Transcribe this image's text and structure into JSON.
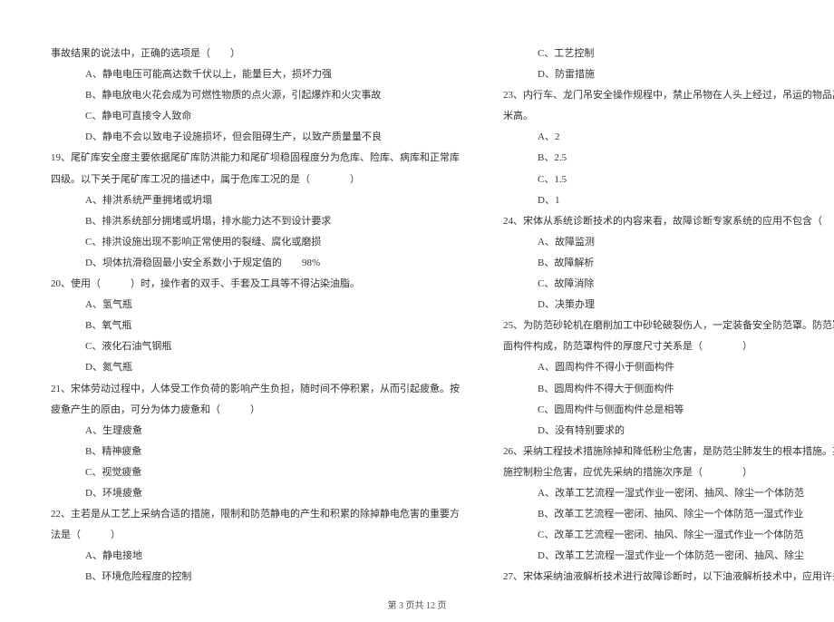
{
  "footer": "第 3 页共 12 页",
  "left": {
    "l0": "事故结果的说法中，正确的选项是（　　）",
    "l0a": "A、静电电压可能高达数千伏以上，能量巨大，损坏力强",
    "l0b": "B、静电放电火花会成为可燃性物质的点火源，引起爆炸和火灾事故",
    "l0c": "C、静电可直接令人致命",
    "l0d": "D、静电不会以致电子设施损坏，但会阻碍生产，以致产质量量不良",
    "q19": "19、尾矿库安全度主要依据尾矿库防洪能力和尾矿坝稳固程度分为危库、险库、病库和正常库",
    "q19b": "四级。以下关于尾矿库工况的描述中，属于危库工况的是（　　　　）",
    "q19A": "A、排洪系统严重拥堵或坍塌",
    "q19B": "B、排洪系统部分拥堵或坍塌，排水能力达不到设计要求",
    "q19C": "C、排洪设施出现不影响正常使用的裂缝、腐化或磨损",
    "q19D": "D、坝体抗滑稳固最小安全系数小于规定值的　　98%",
    "q20": "20、使用（　　　）时，操作者的双手、手套及工具等不得沾染油脂。",
    "q20A": "A、氢气瓶",
    "q20B": "B、氧气瓶",
    "q20C": "C、液化石油气钢瓶",
    "q20D": "D、氮气瓶",
    "q21": "21、宋体劳动过程中，人体受工作负荷的影响产生负担，随时间不停积累，从而引起疲惫。按",
    "q21b": "疲惫产生的原由，可分为体力疲惫和（　　　）",
    "q21A": "A、生理疲惫",
    "q21B": "B、精神疲惫",
    "q21C": "C、视觉疲惫",
    "q21D": "D、环境疲惫",
    "q22": "22、主若是从工艺上采纳合适的措施，限制和防范静电的产生和积累的除掉静电危害的重要方",
    "q22b": "法是（　　　）",
    "q22A": "A、静电接地",
    "q22B": "B、环境危险程度的控制"
  },
  "right": {
    "q22C": "C、工艺控制",
    "q22D": "D、防雷措施",
    "q23": "23、内行车、龙门吊安全操作规程中，禁止吊物在人头上经过，吊运的物品离地不得超出（　　）",
    "q23b": "米高。",
    "q23A": "A、2",
    "q23B": "B、2.5",
    "q23C": "C、1.5",
    "q23D": "D、1",
    "q24": "24、宋体从系统诊断技术的内容来看，故障诊断专家系统的应用不包含（　　　　）",
    "q24A": "A、故障监测",
    "q24B": "B、故障解析",
    "q24C": "C、故障消除",
    "q24D": "D、决策办理",
    "q25": "25、为防范砂轮机在磨削加工中砂轮破裂伤人，一定装备安全防范罩。防范罩由圆周构件和侧",
    "q25b": "面构件构成，防范罩构件的厚度尺寸关系是（　　　　）",
    "q25A": "A、圆周构件不得小于侧面构件",
    "q25B": "B、圆周构件不得大于侧面构件",
    "q25C": "C、圆周构件与侧面构件总是相等",
    "q25D": "D、没有特别要求的",
    "q26": "26、采纳工程技术措施除掉和降低粉尘危害，是防范尘肺发生的根本措施。某石材厂拟采纳措",
    "q26b": "施控制粉尘危害，应优先采纳的措施次序是（　　　　）",
    "q26A": "A、改革工艺流程一湿式作业一密闭、抽风、除尘一个体防范",
    "q26B": "B、改革工艺流程一密闭、抽风、除尘一个体防范一湿式作业",
    "q26C": "C、改革工艺流程一密闭、抽风、除尘一湿式作业一个体防范",
    "q26D": "D、改革工艺流程一湿式作业一个体防范一密闭、抽风、除尘",
    "q27": "27、宋体采纳油液解析技术进行故障诊断时，以下油液解析技术中，应用许多的是（　　　　）"
  }
}
